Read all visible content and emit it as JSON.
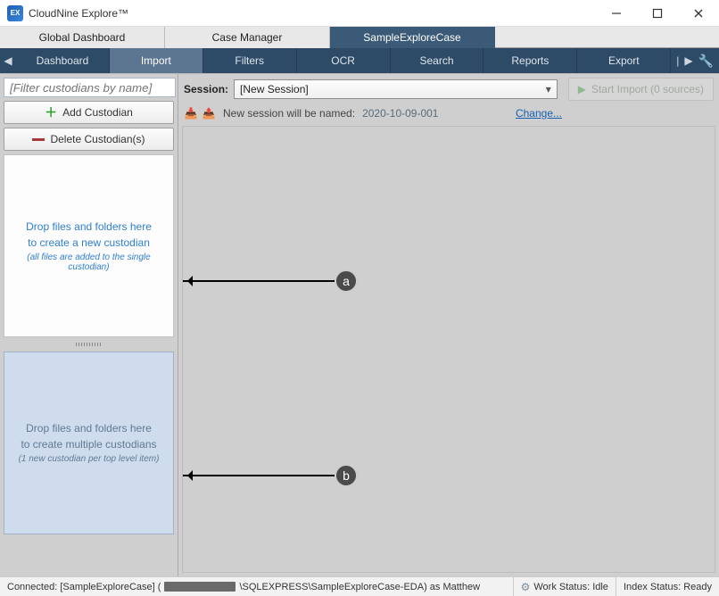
{
  "app": {
    "title": "CloudNine Explore™",
    "icon_label": "EX"
  },
  "window_controls": {
    "minimize": "—",
    "maximize": "▢",
    "close": "✕"
  },
  "top_tabs": [
    {
      "label": "Global Dashboard",
      "active": false
    },
    {
      "label": "Case Manager",
      "active": false
    },
    {
      "label": "SampleExploreCase",
      "active": true
    }
  ],
  "ribbon": {
    "scroll_left": "◀",
    "scroll_right": "▶",
    "wrench": "🔧",
    "divider": "|",
    "items": [
      {
        "label": "Dashboard",
        "active": false
      },
      {
        "label": "Import",
        "active": true
      },
      {
        "label": "Filters",
        "active": false
      },
      {
        "label": "OCR",
        "active": false
      },
      {
        "label": "Search",
        "active": false
      },
      {
        "label": "Reports",
        "active": false
      },
      {
        "label": "Export",
        "active": false
      }
    ]
  },
  "left": {
    "filter_placeholder": "[Filter custodians by name]",
    "refresh_icon": "⟳",
    "add_btn": {
      "icon": "＋",
      "label": "Add Custodian"
    },
    "delete_btn": {
      "label": "Delete Custodian(s)"
    },
    "drop_single": {
      "line1a": "Drop files and folders here",
      "line1b": "to create a new custodian",
      "line2": "(all files are added to the single custodian)"
    },
    "drop_multi": {
      "line1a": "Drop files and folders here",
      "line1b": "to create multiple custodians",
      "line2": "(1 new custodian per top level item)"
    }
  },
  "session": {
    "label": "Session:",
    "selected": "[New Session]",
    "chev": "▾",
    "icon_import": "📥",
    "icon_export": "📤",
    "sub_label": "New session will be named:",
    "sub_value": "2020-10-09-001",
    "change_link": "Change...",
    "start_btn": {
      "icon": "▶",
      "label": "Start Import (0 sources)"
    }
  },
  "callouts": {
    "a": "a",
    "b": "b"
  },
  "status": {
    "connected_prefix": "Connected: [SampleExploreCase] (",
    "connected_suffix": "\\SQLEXPRESS\\SampleExploreCase-EDA) as Matthew",
    "work": "Work Status: Idle",
    "index": "Index Status: Ready",
    "gear": "⚙"
  }
}
